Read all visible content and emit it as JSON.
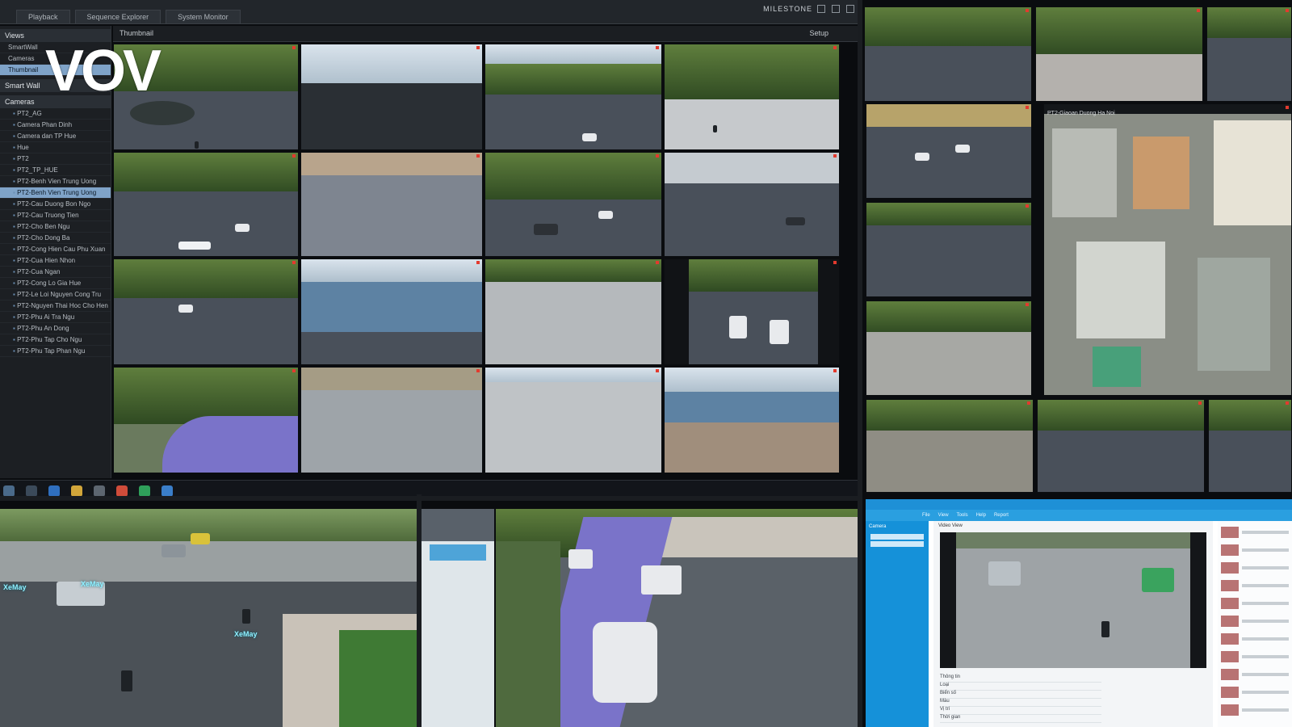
{
  "logo": {
    "text": "VOV"
  },
  "vms": {
    "tabs": [
      "Playback",
      "Sequence Explorer",
      "System Monitor"
    ],
    "brand": "MILESTONE",
    "view_label": "Thumbnail",
    "setup_label": "Setup",
    "sidebar": {
      "sections": [
        "Views",
        "Smart Wall",
        "Cameras"
      ],
      "view_items": [
        "SmartWall",
        "Cameras",
        "Thumbnail"
      ],
      "camera_items": [
        "PT2_AG",
        "Camera Phan Dinh",
        "Camera dan TP Hue",
        "Hue",
        "PT2",
        "PT2_TP_HUE",
        "PT2-Benh Vien Trung Uong",
        "PT2-Benh Vien Trung Uong",
        "PT2-Cau Duong Bon Ngo",
        "PT2-Cau Truong Tien",
        "PT2-Cho Ben Ngu",
        "PT2-Cho Dong Ba",
        "PT2-Cong Hien Cau Phu Xuan",
        "PT2-Cua Hien Nhon",
        "PT2-Cua Ngan",
        "PT2-Cong Lo Gia Hue",
        "PT2-Le Loi Nguyen Cong Tru",
        "PT2-Nguyen Thai Hoc Cho Hen",
        "PT2-Phu Ai Tra Ngu",
        "PT2-Phu An Dong",
        "PT2-Phu Tap Cho Ngu",
        "PT2-Phu Tap Phan Ngu"
      ]
    }
  },
  "overlay_labels": {
    "right_cam": "PT2-Giaoan Duong Ha Noi",
    "ai_tags": [
      "XeMay",
      "XeMay",
      "XeMay"
    ]
  },
  "app": {
    "menu": [
      "File",
      "View",
      "Tools",
      "Help",
      "Report"
    ],
    "side_head": "Camera",
    "main_head": "Video View",
    "details": [
      "Thông tin",
      "Loại",
      "Biển số",
      "Màu",
      "Vị trí",
      "Thời gian"
    ]
  },
  "colors": {
    "accent_blue": "#1e90d6",
    "record_red": "#e33a2e",
    "selected": "#7fa3c8",
    "ai_lane": "#7a73c9",
    "ai_tag": "#8ff0ff"
  }
}
